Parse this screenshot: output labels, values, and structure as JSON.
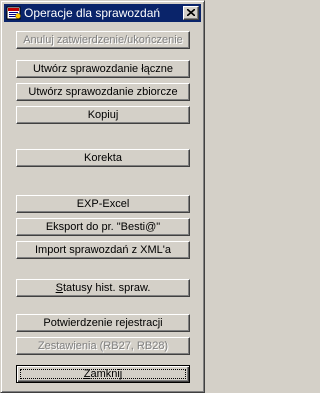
{
  "window": {
    "title": "Operacje dla sprawozdań",
    "title_icon": "app-icon",
    "close_icon": "close-icon"
  },
  "buttons": {
    "cancel_approval": "Anuluj zatwierdzenie/ukończenie",
    "create_combined": "Utwórz sprawozdanie łączne",
    "create_summary": "Utwórz sprawozdanie zbiorcze",
    "copy": "Kopiuj",
    "correction": "Korekta",
    "exp_excel": "EXP-Excel",
    "export_besti": "Eksport do pr. \"Besti@\"",
    "import_xml": "Import sprawozdań z XML'a",
    "status_history_first": "S",
    "status_history_rest": "tatusy hist. spraw.",
    "confirm_registration": "Potwierdzenie rejestracji",
    "statements": "Zestawienia (RB27, RB28)",
    "close_first": "Z",
    "close_rest": "amknij"
  },
  "colors": {
    "face": "#d4d0c8",
    "titlebar": "#0a246a",
    "disabled_text": "#808080"
  }
}
